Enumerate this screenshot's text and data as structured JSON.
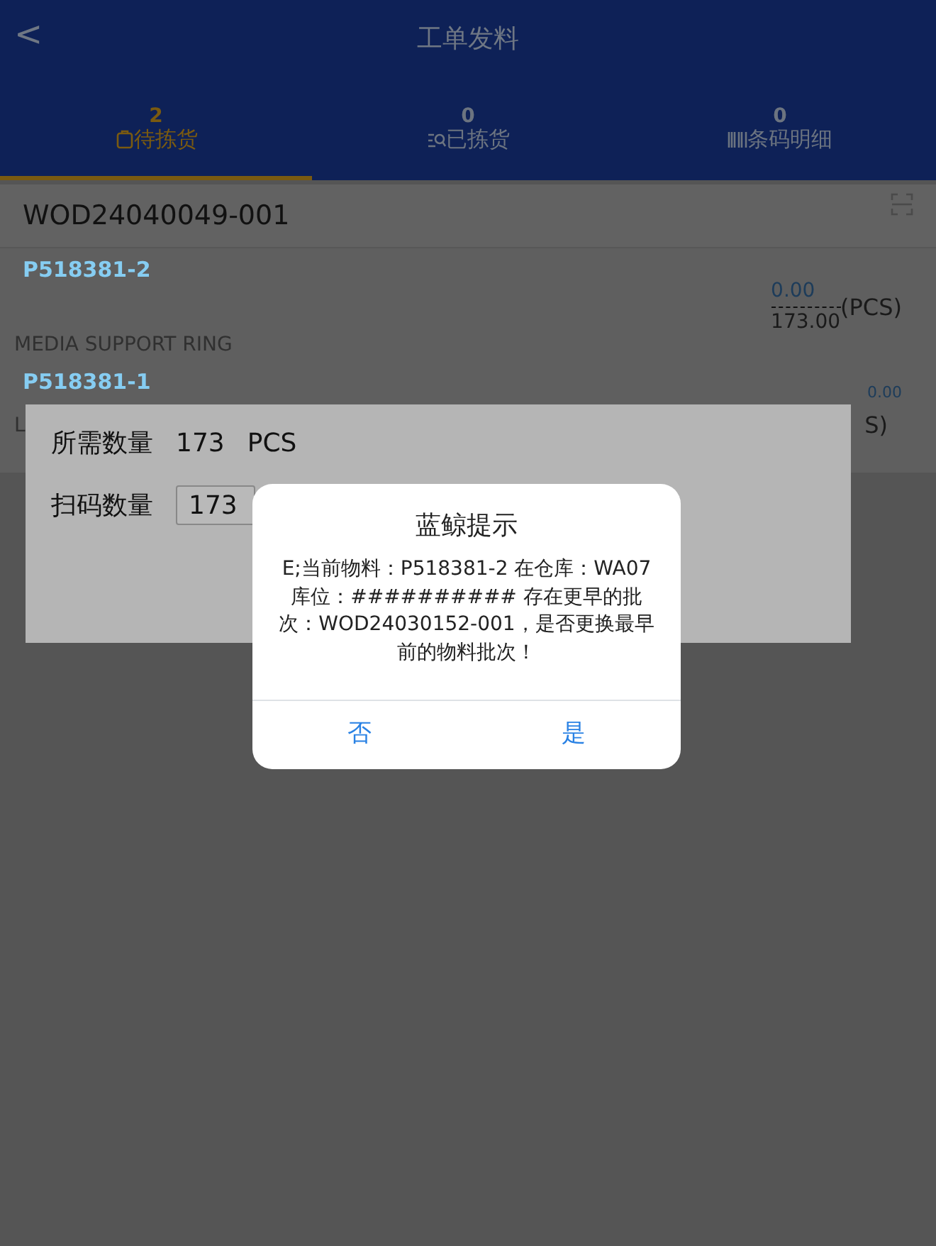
{
  "header": {
    "back": "<",
    "title": "工单发料"
  },
  "tabs": [
    {
      "count": "2",
      "label": "待拣货",
      "kind": "clipboard",
      "selected": true
    },
    {
      "count": "0",
      "label": "已拣货",
      "kind": "search",
      "selected": false
    },
    {
      "count": "0",
      "label": "条码明细",
      "kind": "barcode",
      "selected": false
    }
  ],
  "order": {
    "number": "WOD24040049-001"
  },
  "items": [
    {
      "code": "P518381-2",
      "description": "MEDIA SUPPORT RING",
      "done": "0.00",
      "required": "173.00",
      "unit": "(PCS)"
    },
    {
      "code": "P518381-1",
      "description": "L",
      "done": "0.00",
      "unit": "S)"
    }
  ],
  "panel": {
    "required_label": "所需数量",
    "required_value": "173",
    "required_unit": "PCS",
    "scan_label": "扫码数量",
    "scan_value": "173"
  },
  "dialog": {
    "title": "蓝鲸提示",
    "message": "E;当前物料：P518381-2 在仓库：WA07 库位：########## 存在更早的批次：WOD24030152-001，是否更换最早前的物料批次！",
    "buttons": [
      "否",
      "是"
    ]
  }
}
